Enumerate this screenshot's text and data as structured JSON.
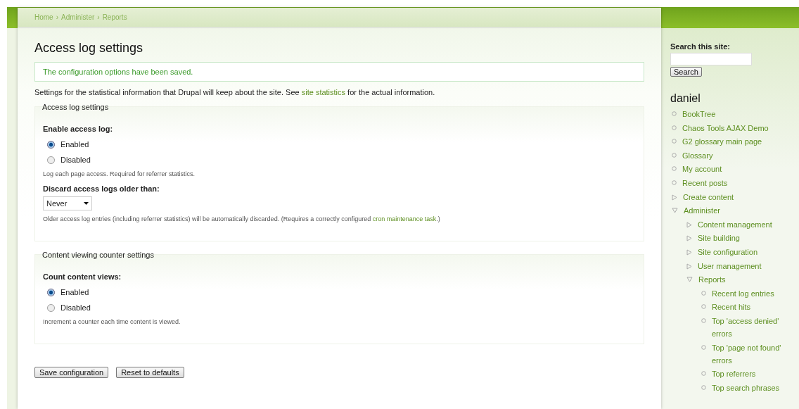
{
  "breadcrumb": [
    "Home",
    "Administer",
    "Reports"
  ],
  "breadcrumb_separator": "›",
  "title": "Access log settings",
  "message": "The configuration options have been saved.",
  "intro": {
    "text": "Settings for the statistical information that Drupal will keep about the site. See ",
    "link": "site statistics",
    "text_end": " for the actual information."
  },
  "fieldsets": [
    {
      "legend": "Access log settings",
      "fields": [
        {
          "kind": "radios",
          "label": "Enable access log:",
          "options": [
            {
              "label": "Enabled",
              "selected": true
            },
            {
              "label": "Disabled",
              "selected": false
            }
          ],
          "description": "Log each page access. Required for referrer statistics."
        },
        {
          "kind": "select",
          "label": "Discard access logs older than:",
          "value": "Never",
          "description": "Older access log entries (including referrer statistics) will be automatically discarded. (Requires a correctly configured ",
          "link": "cron maintenance task",
          "description_end": ".)"
        }
      ]
    },
    {
      "legend": "Content viewing counter settings",
      "fields": [
        {
          "kind": "radios",
          "label": "Count content views:",
          "options": [
            {
              "label": "Enabled",
              "selected": true
            },
            {
              "label": "Disabled",
              "selected": false
            }
          ],
          "description": "Increment a counter each time content is viewed."
        }
      ]
    }
  ],
  "buttons": [
    "Save configuration",
    "Reset to defaults"
  ],
  "sidebar": {
    "search_label": "Search this site:",
    "search_button": "Search",
    "user": "daniel",
    "menu": [
      {
        "label": "BookTree",
        "kind": "leaf"
      },
      {
        "label": "Chaos Tools AJAX Demo",
        "kind": "leaf"
      },
      {
        "label": "G2 glossary main page",
        "kind": "leaf"
      },
      {
        "label": "Glossary",
        "kind": "leaf"
      },
      {
        "label": "My account",
        "kind": "leaf"
      },
      {
        "label": "Recent posts",
        "kind": "leaf"
      },
      {
        "label": "Create content",
        "kind": "collapsed"
      },
      {
        "label": "Administer",
        "kind": "expanded",
        "children": [
          {
            "label": "Content management",
            "kind": "collapsed"
          },
          {
            "label": "Site building",
            "kind": "collapsed"
          },
          {
            "label": "Site configuration",
            "kind": "collapsed"
          },
          {
            "label": "User management",
            "kind": "collapsed"
          },
          {
            "label": "Reports",
            "kind": "expanded",
            "children": [
              {
                "label": "Recent log entries",
                "kind": "leaf"
              },
              {
                "label": "Recent hits",
                "kind": "leaf"
              },
              {
                "label": "Top 'access denied' errors",
                "kind": "leaf"
              },
              {
                "label": "Top 'page not found' errors",
                "kind": "leaf"
              },
              {
                "label": "Top referrers",
                "kind": "leaf"
              },
              {
                "label": "Top search phrases",
                "kind": "leaf"
              }
            ]
          }
        ]
      }
    ]
  }
}
